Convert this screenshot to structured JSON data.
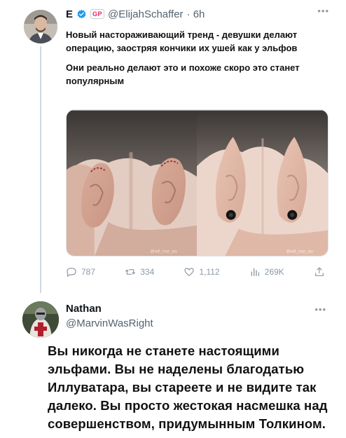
{
  "tweet1": {
    "display_name": "E",
    "affiliate_badge": "GP",
    "handle": "@ElijahSchaffer",
    "time": "· 6h",
    "paragraph1": "Новый настораживающий тренд - девушки делают операцию, заостряя кончики их ушей как у эльфов",
    "paragraph2": "Они реально делают это и похоже скоро это станет популярным",
    "media_watermark_left": "@will_tsar_tas",
    "media_watermark_right": "@will_tsar_tas",
    "stats": {
      "replies": "787",
      "retweets": "334",
      "likes": "1,112",
      "views": "269K"
    }
  },
  "tweet2": {
    "display_name": "Nathan",
    "handle": "@MarvinWasRight",
    "text": "Вы никогда не станете настоящими эльфами. Вы не наделены благодатью Иллуватара, вы стареете и не видите так далеко.  Вы просто жестокая насмешка над совершенством, придумынным Толкином."
  },
  "colors": {
    "verified_blue": "#1d9bf0",
    "muted_text": "#536471",
    "icon_gray": "#8b98a5",
    "thread_line": "#cfd9de"
  },
  "icons": [
    "more-icon",
    "verified-icon",
    "reply-icon",
    "retweet-icon",
    "like-icon",
    "views-icon",
    "share-icon"
  ]
}
